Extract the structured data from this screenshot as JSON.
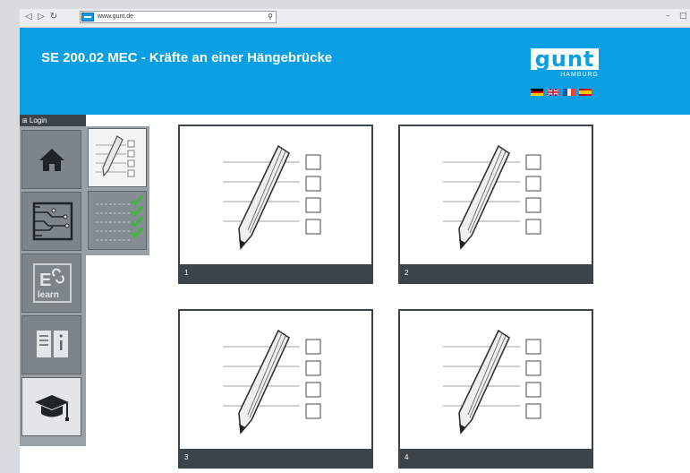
{
  "browser": {
    "url": "www.gunt.de",
    "back_icon": "triangle-left",
    "forward_icon": "triangle-right",
    "reload_icon": "reload",
    "minimize_label": "–",
    "maximize_label": "□"
  },
  "header": {
    "title": "SE 200.02 MEC - Kräfte an einer Hängebrücke",
    "logo_text": "gunt",
    "logo_subtext": "HAMBURG",
    "languages": [
      "de",
      "en",
      "fr",
      "es"
    ]
  },
  "sidebar": {
    "login_label": "Login",
    "items": [
      {
        "name": "home",
        "icon": "house-icon"
      },
      {
        "name": "circuit",
        "icon": "circuit-board-icon"
      },
      {
        "name": "elearn",
        "icon": "elearn-icon",
        "label_top": "E",
        "label_bottom": "learn"
      },
      {
        "name": "info",
        "icon": "book-info-icon"
      },
      {
        "name": "education",
        "icon": "graduation-cap-icon"
      }
    ]
  },
  "submenu": {
    "items": [
      {
        "name": "quiz",
        "icon": "checklist-pencil-icon"
      },
      {
        "name": "results",
        "icon": "checkmarks-icon"
      }
    ]
  },
  "cards": [
    {
      "label": "1"
    },
    {
      "label": "2"
    },
    {
      "label": "3"
    },
    {
      "label": "4"
    }
  ],
  "colors": {
    "header_blue": "#0a9fe2",
    "dark": "#3d4449",
    "sidebar_grey": "#9aa1a6",
    "check_green": "#3cb83a"
  }
}
